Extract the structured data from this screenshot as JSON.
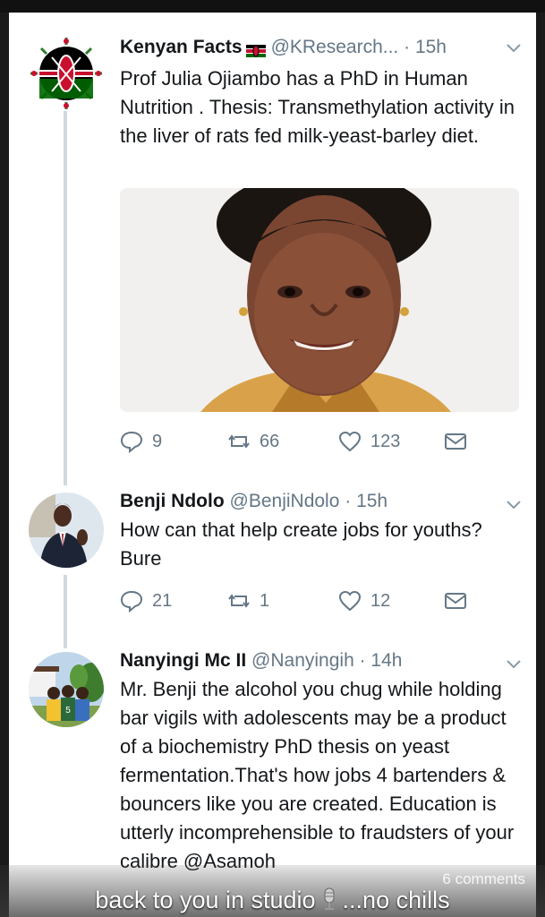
{
  "tweets": [
    {
      "name": "Kenyan Facts",
      "handle": "@KResearch...",
      "time": "· 15h",
      "text": "Prof Julia Ojiambo has a PhD in Human Nutrition . Thesis: Transmethylation activity in the liver of rats fed milk-yeast-barley diet.",
      "replies": "9",
      "retweets": "66",
      "likes": "123"
    },
    {
      "name": "Benji Ndolo",
      "handle": "@BenjiNdolo",
      "time": "· 15h",
      "text": "How can that help create jobs for youths? Bure",
      "replies": "21",
      "retweets": "1",
      "likes": "12"
    },
    {
      "name": "Nanyingi Mc II",
      "handle": "@Nanyingih",
      "time": "· 14h",
      "text": "Mr. Benji the alcohol you chug while holding bar vigils with adolescents may be a product of a biochemistry PhD thesis on yeast fermentation.That's how jobs 4 bartenders & bouncers like you are created. Education is utterly incomprehensible to fraudsters of your calibre @Asamoh"
    }
  ],
  "overlay": {
    "comments": "6 comments",
    "caption_left": "back to you in studio",
    "caption_right": "...no chills"
  },
  "icons": {
    "reply": "reply-icon",
    "retweet": "retweet-icon",
    "like": "heart-icon",
    "dm": "envelope-icon",
    "chevron": "chevron-down-icon",
    "mic": "microphone-icon"
  },
  "colors": {
    "text": "#14171a",
    "muted": "#657786",
    "thread": "#cfd9de"
  }
}
